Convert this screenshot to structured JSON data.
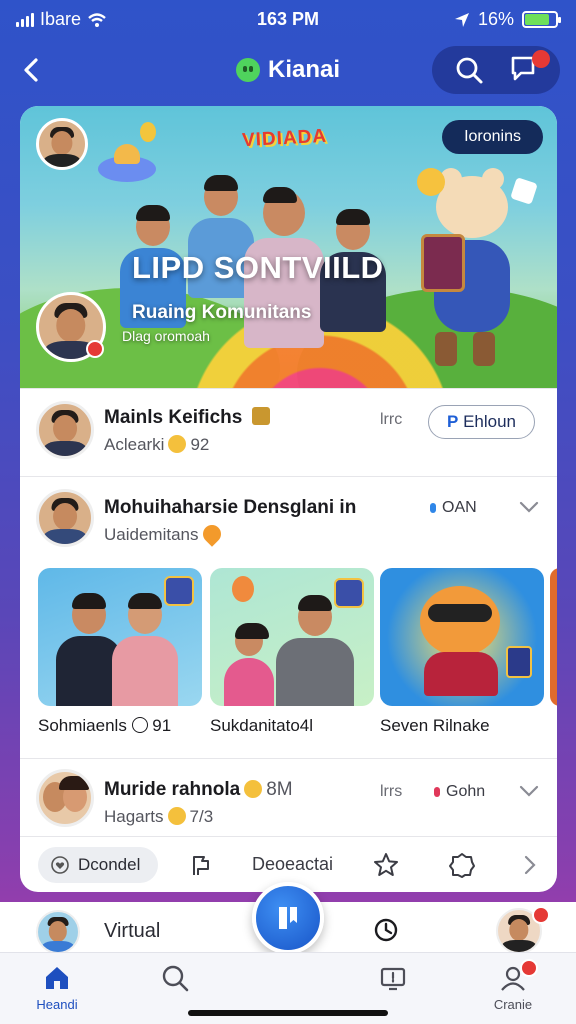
{
  "status_bar": {
    "carrier": "Ibare",
    "time": "163 PM",
    "battery": "16%",
    "battery_level": 0.8
  },
  "header": {
    "back_icon": "chevron-left-icon",
    "app_name": "Kianai",
    "search_icon": "search-icon",
    "chat_icon": "chat-bubble-icon"
  },
  "banner": {
    "logo_text": "VIDIADA",
    "pill_label": "Ioronins",
    "title": "LIPD SONTVIILD",
    "subtitle": "Ruaing Komunitans",
    "meta": "Dlag oromoah"
  },
  "rows": [
    {
      "title": "Mainls Keifichs",
      "subtitle": "Aclearki",
      "subtitle_count": "92",
      "meta": "lrrc",
      "button_icon": "P",
      "button_label": "Ehloun"
    },
    {
      "title": "Mohuihaharsie Densglani in",
      "subtitle": "Uaidemitans",
      "tag_label": "OAN",
      "tag_color": "#2f86e8",
      "chevron_icon": "chevron-down-icon"
    }
  ],
  "media": [
    {
      "label": "Sohmiaenls",
      "count": "91"
    },
    {
      "label": "Sukdanitato4l"
    },
    {
      "label": "Seven Rilnake"
    }
  ],
  "row3": {
    "title": "Muride rahnola",
    "title_count": "8M",
    "subtitle": "Hagarts",
    "subtitle_count": "7/3",
    "meta": "lrrs",
    "tag_label": "Gohn",
    "tag_color": "#e0385a",
    "chevron_icon": "chevron-down-icon"
  },
  "action_row": {
    "chip_label": "Dcondel",
    "text": "Deoeactai"
  },
  "bottom_strip": {
    "label": "Virtual"
  },
  "tabbar": {
    "tabs": [
      {
        "label": "Heandi",
        "icon": "home-icon"
      },
      {
        "label": "",
        "icon": "search-icon"
      },
      {
        "label": "",
        "icon": "tv-icon"
      },
      {
        "label": "Cranie",
        "icon": "profile-icon"
      }
    ]
  },
  "colors": {
    "accent": "#1e5fd6",
    "brand_green": "#4fd35d",
    "badge_red": "#e53935"
  }
}
